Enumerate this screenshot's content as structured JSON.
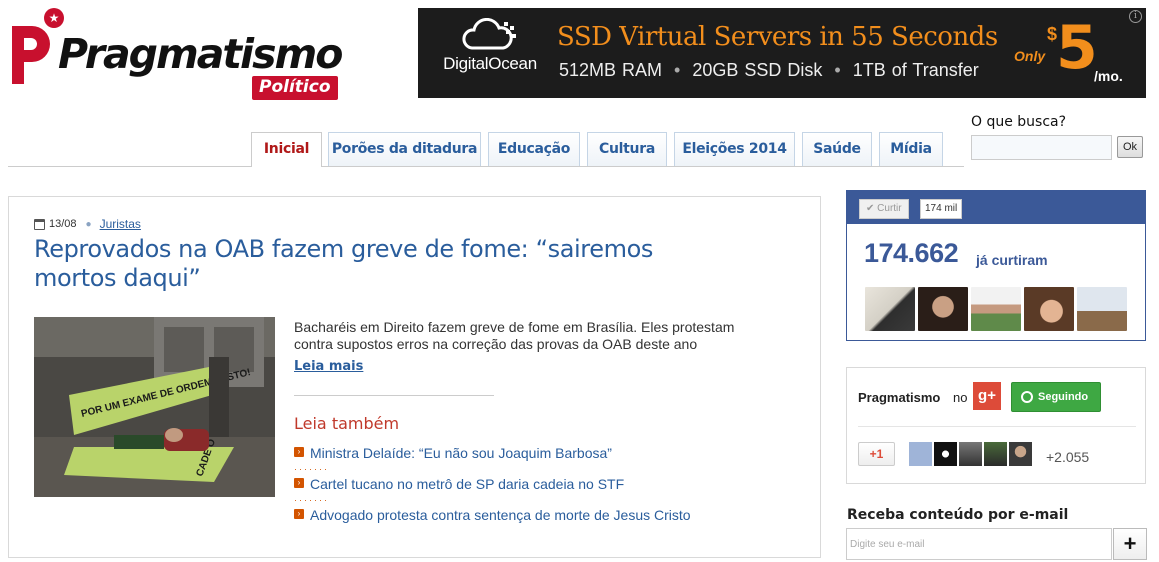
{
  "site": {
    "logo_text": "Pragmatismo",
    "logo_sub": "Político"
  },
  "ad": {
    "brand": "DigitalOcean",
    "headline": "SSD Virtual Servers in 55 Seconds",
    "specs": [
      "512MB RAM",
      "20GB SSD Disk",
      "1TB of Transfer"
    ],
    "only": "Only",
    "currency": "$",
    "price": "5",
    "period": "/mo.",
    "info_icon": "info-icon"
  },
  "nav": {
    "tabs": [
      {
        "label": "Inicial",
        "active": true
      },
      {
        "label": "Porões da ditadura"
      },
      {
        "label": "Educação"
      },
      {
        "label": "Cultura"
      },
      {
        "label": "Eleições 2014"
      },
      {
        "label": "Saúde"
      },
      {
        "label": "Mídia"
      }
    ]
  },
  "search": {
    "label": "O que busca?",
    "value": "",
    "button": "Ok"
  },
  "article": {
    "date": "13/08",
    "category": "Juristas",
    "title": "Reprovados na OAB fazem greve de fome: “sairemos mortos daqui”",
    "excerpt": "Bacharéis em Direito fazem greve de fome em Brasília. Eles protestam contra supostos erros na correção das provas da OAB deste ano",
    "read_more": "Leia mais",
    "related_title": "Leia também",
    "related": [
      "Ministra Delaíde: “Eu não sou Joaquim Barbosa”",
      "Cartel tucano no metrô de SP daria cadeia no STF",
      "Advogado protesta contra sentença de morte de Jesus Cristo"
    ]
  },
  "facebook": {
    "like_label": "✔ Curtir",
    "like_count_short": "174 mil",
    "count": "174.662",
    "count_suffix": "já curtiram"
  },
  "gplus": {
    "page_name": "Pragmatismo",
    "on_label": "no",
    "logo": "g+",
    "follow_label": "Seguindo",
    "plus_one": "+1",
    "count": "+2.055"
  },
  "newsletter": {
    "title": "Receba conteúdo por e-mail",
    "placeholder": "Digite seu e-mail",
    "submit": "+"
  },
  "colors": {
    "brand_red": "#c8102e",
    "link_blue": "#2a5d9c",
    "fb_blue": "#3b5998",
    "gplus_red": "#dd4b39",
    "follow_green": "#3ea843",
    "ad_orange": "#f28e1c"
  }
}
